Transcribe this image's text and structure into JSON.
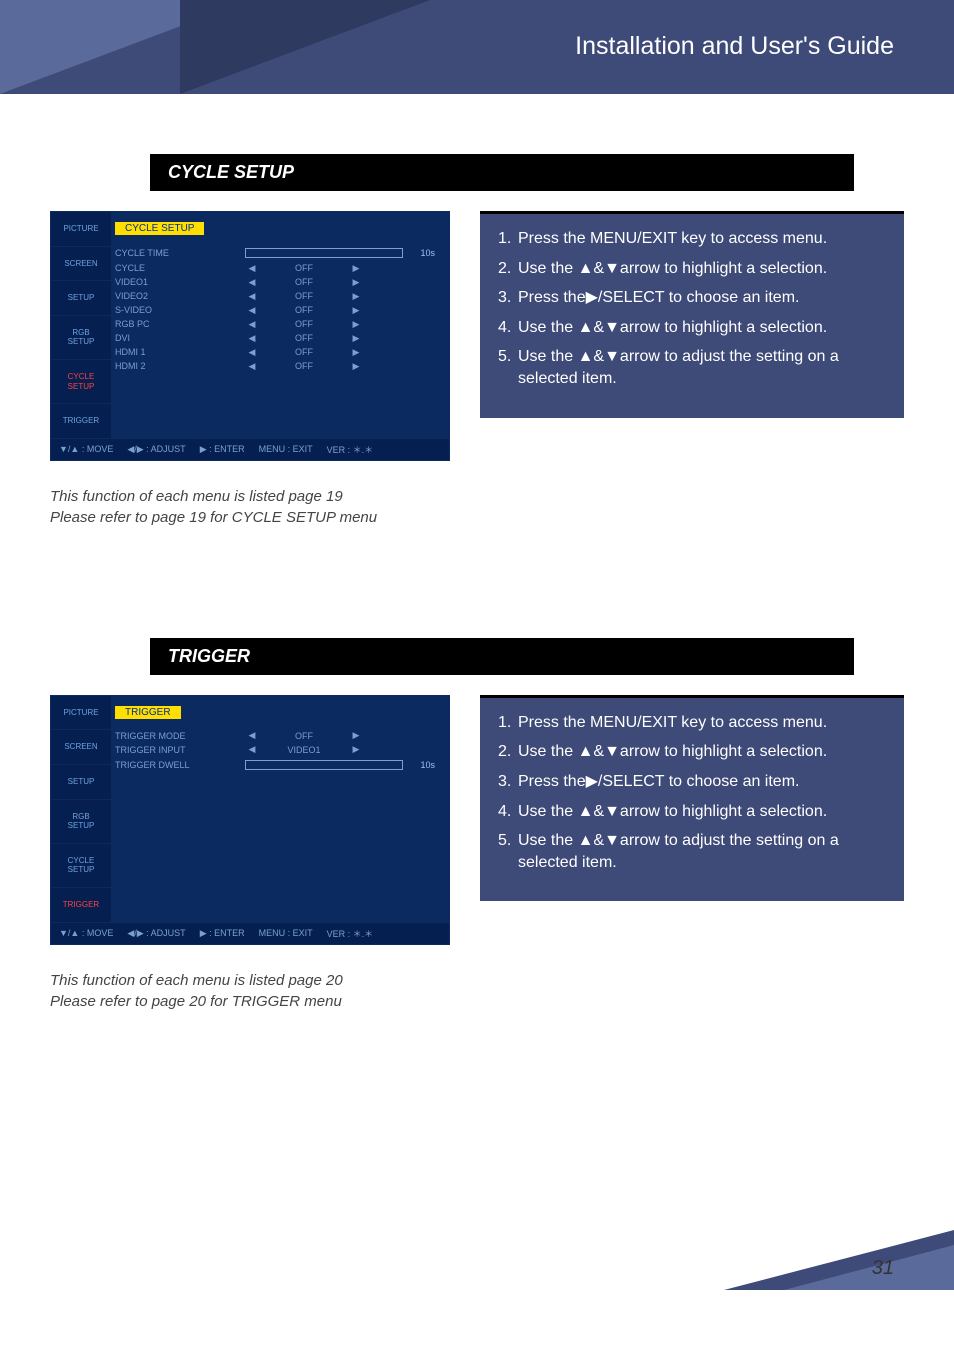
{
  "banner_title": "Installation and User's Guide",
  "page_number": "31",
  "sections": {
    "cycle": {
      "header": "CYCLE SETUP",
      "osd": {
        "title": "CYCLE SETUP",
        "tabs": [
          "PICTURE",
          "SCREEN",
          "SETUP",
          "RGB\nSETUP",
          "CYCLE\nSETUP",
          "TRIGGER"
        ],
        "active_tab_index": 4,
        "slider": {
          "label": "CYCLE TIME",
          "value": "10s"
        },
        "rows": [
          {
            "label": "CYCLE",
            "val": "OFF"
          },
          {
            "label": "VIDEO1",
            "val": "OFF"
          },
          {
            "label": "VIDEO2",
            "val": "OFF"
          },
          {
            "label": "S-VIDEO",
            "val": "OFF"
          },
          {
            "label": "RGB PC",
            "val": "OFF"
          },
          {
            "label": "DVI",
            "val": "OFF"
          },
          {
            "label": "HDMI 1",
            "val": "OFF"
          },
          {
            "label": "HDMI 2",
            "val": "OFF"
          }
        ],
        "footer": {
          "move": "▼/▲ : MOVE",
          "adjust": "◀/▶ : ADJUST",
          "enter": "▶ : ENTER",
          "exit": "MENU : EXIT",
          "ver": "VER : ＊.＊"
        }
      },
      "caption_line1": "This function of each menu is listed page 19",
      "caption_line2": "Please refer to page 19 for CYCLE SETUP menu",
      "instructions": [
        {
          "n": "1.",
          "pre": "Press the MENU/EXIT key to access menu."
        },
        {
          "n": "2.",
          "pre": "Use the ▲&▼arrow to highlight a selection."
        },
        {
          "n": "3.",
          "pre": "Press the▶/SELECT to choose an item."
        },
        {
          "n": "4.",
          "pre": "Use the ▲&▼arrow to highlight a selection."
        },
        {
          "n": "5.",
          "pre": "Use the ▲&▼arrow to adjust the setting on a selected item."
        }
      ]
    },
    "trigger": {
      "header": "TRIGGER",
      "osd": {
        "title": "TRIGGER",
        "tabs": [
          "PICTURE",
          "SCREEN",
          "SETUP",
          "RGB\nSETUP",
          "CYCLE\nSETUP",
          "TRIGGER"
        ],
        "active_tab_index": 5,
        "slider": {
          "label": "TRIGGER DWELL",
          "value": "10s"
        },
        "rows": [
          {
            "label": "TRIGGER MODE",
            "val": "OFF"
          },
          {
            "label": "TRIGGER INPUT",
            "val": "VIDEO1"
          }
        ],
        "footer": {
          "move": "▼/▲ : MOVE",
          "adjust": "◀/▶ : ADJUST",
          "enter": "▶ : ENTER",
          "exit": "MENU : EXIT",
          "ver": "VER : ＊.＊"
        }
      },
      "caption_line1": "This function of each menu is listed page 20",
      "caption_line2": "Please refer to page 20 for TRIGGER menu",
      "instructions": [
        {
          "n": "1.",
          "pre": "Press the MENU/EXIT key to access menu."
        },
        {
          "n": "2.",
          "pre": "Use the ▲&▼arrow to highlight a selection."
        },
        {
          "n": "3.",
          "pre": "Press the▶/SELECT to choose an item."
        },
        {
          "n": "4.",
          "pre": "Use the ▲&▼arrow to highlight a selection."
        },
        {
          "n": "5.",
          "pre": "Use the ▲&▼arrow to adjust the setting on a selected item."
        }
      ]
    }
  }
}
